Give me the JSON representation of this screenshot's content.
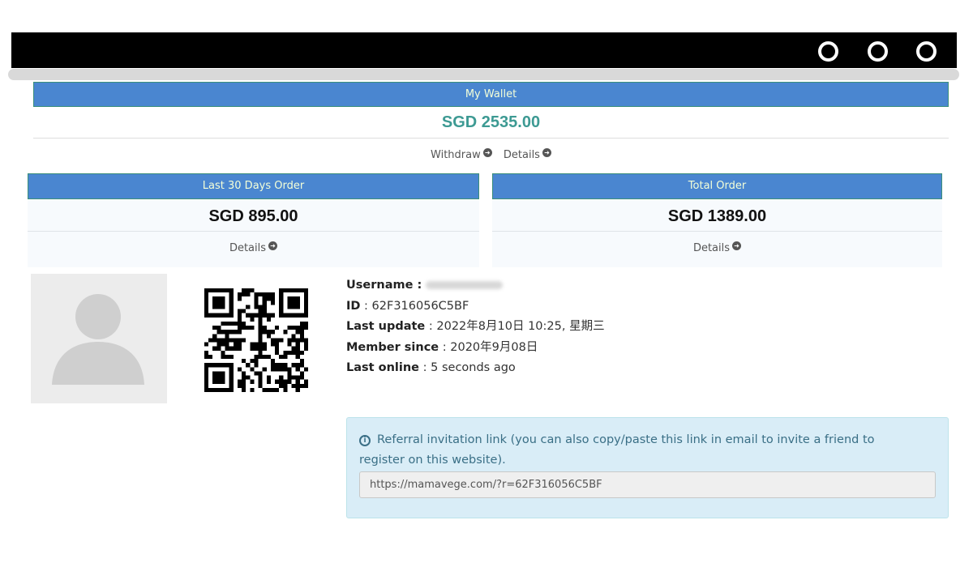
{
  "window": {
    "buttons": [
      "circle",
      "circle",
      "circle"
    ]
  },
  "wallet": {
    "title": "My Wallet",
    "amount": "SGD 2535.00",
    "withdraw_label": "Withdraw",
    "details_label": "Details"
  },
  "last30": {
    "title": "Last 30 Days Order",
    "amount": "SGD 895.00",
    "details_label": "Details"
  },
  "total": {
    "title": "Total Order",
    "amount": "SGD 1389.00",
    "details_label": "Details"
  },
  "profile": {
    "username_label": "Username :",
    "id_label": "ID",
    "id_value": ": 62F316056C5BF",
    "last_update_label": "Last update",
    "last_update_value": ": 2022年8月10日 10:25, 星期三",
    "member_since_label": "Member since",
    "member_since_value": ": 2020年9月08日",
    "last_online_label": "Last online",
    "last_online_value": ": 5 seconds ago"
  },
  "referral": {
    "text_line1": "Referral invitation link (you can also copy/paste this link in email to invite a friend to",
    "text_line2": "register on this website).",
    "link_value": "https://mamavege.com/?r=62F316056C5BF"
  },
  "colors": {
    "panel_header": "#4a86d0",
    "wallet_amount": "#3d9a93",
    "referral_bg": "#d9edf7"
  }
}
